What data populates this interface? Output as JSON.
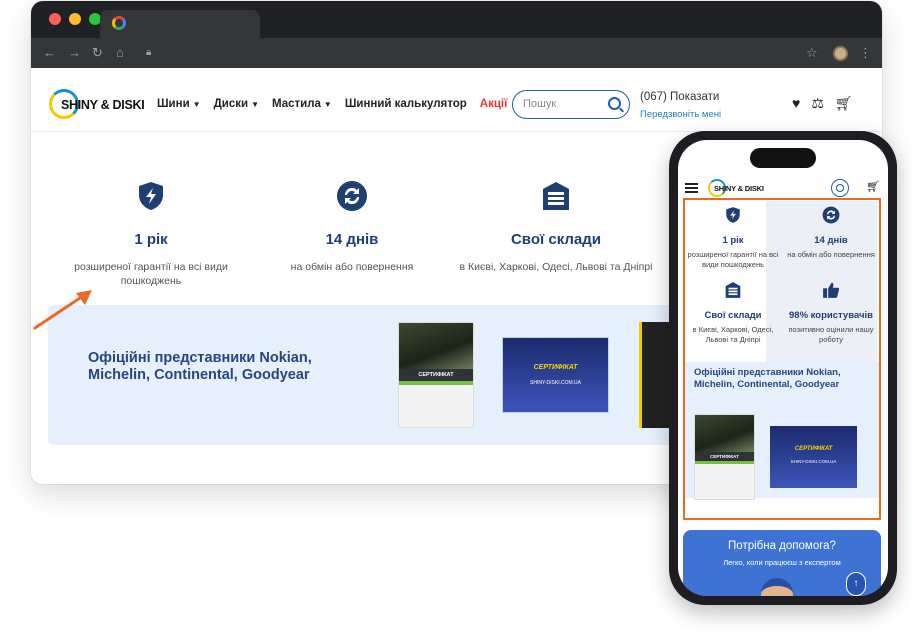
{
  "header": {
    "logo_text": "SHINY & DISKI",
    "menu": [
      {
        "label": "Шини",
        "has_dropdown": true
      },
      {
        "label": "Диски",
        "has_dropdown": true
      },
      {
        "label": "Мастила",
        "has_dropdown": true
      },
      {
        "label": "Шинний калькулятор",
        "has_dropdown": false
      },
      {
        "label": "Акції",
        "has_dropdown": false
      }
    ],
    "search_placeholder": "Пошук",
    "phone": "(067) Показати",
    "callback": "Передзвоніть мені"
  },
  "features": [
    {
      "icon": "shield-bolt-icon",
      "title": "1 рік",
      "desc": "розширеної гарантії на всі види пошкоджень"
    },
    {
      "icon": "return-arrows-icon",
      "title": "14 днів",
      "desc": "на обмін або повернення"
    },
    {
      "icon": "warehouse-icon",
      "title": "Свої склади",
      "desc": "в Києві, Харкові, Одесі, Львові та Дніпрі"
    }
  ],
  "banner": {
    "title": "Офіційні представники Nokian, Michelin, Continental, Goodyear",
    "cert1_label": "СЕРТИФІКАТ",
    "cert2_label": "СЕРТИФІКАТ",
    "cert2_site": "SHINY-DISKI.COM.UA"
  },
  "mobile": {
    "logo_text": "SHINY & DISKI",
    "features": [
      {
        "icon": "shield-bolt-icon",
        "title": "1 рік",
        "desc": "розширеної гарантії на всі види пошкоджень"
      },
      {
        "icon": "return-arrows-icon",
        "title": "14 днів",
        "desc": "на обмін або повернення"
      },
      {
        "icon": "warehouse-icon",
        "title": "Свої склади",
        "desc": "в Києві, Харкові, Одесі, Львові та Дніпрі"
      },
      {
        "icon": "thumbs-up-icon",
        "title": "98% користувачів",
        "desc": "позитивно оцінили нашу роботу"
      }
    ],
    "banner_title": "Офіційні представники Nokian, Michelin, Continental, Goodyear",
    "cert1_label": "СЕРТИФІКАТ",
    "cert2_label": "СЕРТИФІКАТ",
    "cert2_site": "SHINY-DISKI.COM.UA",
    "help_title": "Потрібна допомога?",
    "help_subtitle": "Легко, коли працюєш з експертом",
    "scroll_up": "↑"
  },
  "colors": {
    "brand_blue": "#1f3e74",
    "accent_blue": "#1f5ea8",
    "promo_red": "#e53935",
    "highlight_orange": "#ea6a2a",
    "banner_bg": "#e6effc"
  }
}
